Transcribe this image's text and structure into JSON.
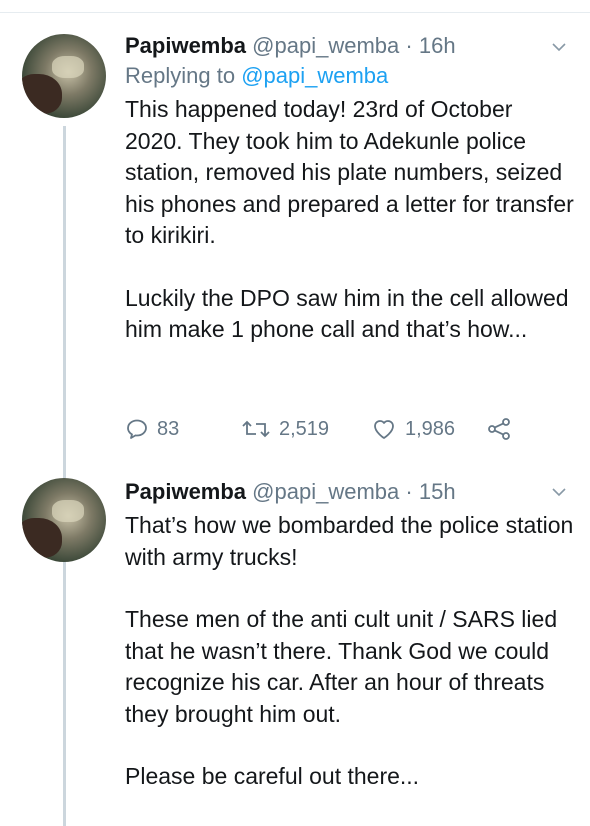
{
  "tweets": [
    {
      "name": "Papiwemba",
      "handle": "@papi_wemba",
      "dot": "·",
      "time": "16h",
      "replying_prefix": "Replying to ",
      "replying_mention": "@papi_wemba",
      "paragraphs": [
        "This happened today! 23rd of October 2020. They took him to Adekunle police station, removed his plate numbers, seized his phones and prepared a letter for transfer to kirikiri.",
        "Luckily the DPO saw him in the cell allowed him make 1 phone call and that’s how..."
      ],
      "replies": "83",
      "retweets": "2,519",
      "likes": "1,986"
    },
    {
      "name": "Papiwemba",
      "handle": "@papi_wemba",
      "dot": "·",
      "time": "15h",
      "paragraphs": [
        "That’s how we bombarded the police station with army trucks!",
        "These men of the anti cult unit / SARS lied that he wasn’t there. Thank God we could recognize his car. After an hour of threats they brought him out.",
        "Please be careful out there..."
      ]
    }
  ],
  "icons": {
    "reply": "reply-icon",
    "retweet": "retweet-icon",
    "like": "heart-icon",
    "share": "share-icon",
    "more": "chevron-down-icon"
  },
  "colors": {
    "text": "#14171a",
    "secondary": "#657786",
    "link": "#1da1f2",
    "thread_line": "#ccd6dd"
  }
}
